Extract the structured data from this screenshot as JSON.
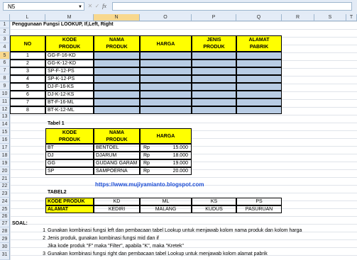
{
  "formula_bar": {
    "name_box": "N5",
    "fx": "fx",
    "formula": ""
  },
  "columns": [
    "L",
    "M",
    "N",
    "O",
    "P",
    "Q",
    "R",
    "S",
    "T"
  ],
  "rows": [
    "1",
    "2",
    "3",
    "4",
    "5",
    "6",
    "7",
    "8",
    "9",
    "10",
    "11",
    "12",
    "13",
    "14",
    "15",
    "16",
    "17",
    "18",
    "19",
    "20",
    "21",
    "22",
    "23",
    "24",
    "25",
    "26",
    "27",
    "28",
    "29",
    "30",
    "31"
  ],
  "title": "Penggunaan Fungsi LOOKUP, If,Left, Right",
  "main_table": {
    "headers": [
      "NO",
      "KODE PRODUK",
      "NAMA PRODUK",
      "HARGA",
      "JENIS PRODUK",
      "ALAMAT PABRIK"
    ],
    "rows": [
      {
        "no": "1",
        "kode": "GG-F-16-KD"
      },
      {
        "no": "2",
        "kode": "GG-K-12-KD"
      },
      {
        "no": "3",
        "kode": "SP-F-12-PS"
      },
      {
        "no": "4",
        "kode": "SP-K-12-PS"
      },
      {
        "no": "5",
        "kode": "DJ-F-16-KS"
      },
      {
        "no": "6",
        "kode": "DJ-K-12-KS"
      },
      {
        "no": "7",
        "kode": "BT-F-16-ML"
      },
      {
        "no": "8",
        "kode": "BT-K-12-ML"
      }
    ]
  },
  "tabel1": {
    "title": "Tabel 1",
    "headers": [
      "KODE PRODUK",
      "NAMA PRODUK",
      "HARGA"
    ],
    "rows": [
      {
        "kode": "BT",
        "nama": "BENTOEL",
        "rp": "Rp",
        "harga": "15.000"
      },
      {
        "kode": "DJ",
        "nama": "DJARUM",
        "rp": "Rp",
        "harga": "18.000"
      },
      {
        "kode": "GG",
        "nama": "GUDANG GARAM",
        "rp": "Rp",
        "harga": "19.000"
      },
      {
        "kode": "SP",
        "nama": "SAMPOERNA",
        "rp": "Rp",
        "harga": "20.000"
      }
    ]
  },
  "url": "https://www.mujiyamianto.blogspot.com",
  "tabel2": {
    "title": "TABEL2",
    "row1_label": "KODE PRODUK",
    "row2_label": "ALAMAT",
    "codes": [
      "KD",
      "ML",
      "KS",
      "PS"
    ],
    "addresses": [
      "KEDIRI",
      "MALANG",
      "KUDUS",
      "PASURUAN"
    ]
  },
  "soal": {
    "label": "SOAL:",
    "items": [
      {
        "num": "1",
        "text": "Gunakan kombinasi fungsi left dan pembacaan tabel Lookup untuk menjawab kolom nama produk dan kolom harga"
      },
      {
        "num": "2",
        "text": "Jenis produk, gunakan kombinasi fungsi mid dan if"
      },
      {
        "num": "",
        "text": "Jika kode produk \"F\" maka \"Filter\", apabila \"K\", maka \"Kretek\""
      },
      {
        "num": "3",
        "text": "Gunakan kombinasi fungsi right  dan pembacaan tabel Lookup untuk menjawab kolom alamat pabrik"
      }
    ]
  }
}
